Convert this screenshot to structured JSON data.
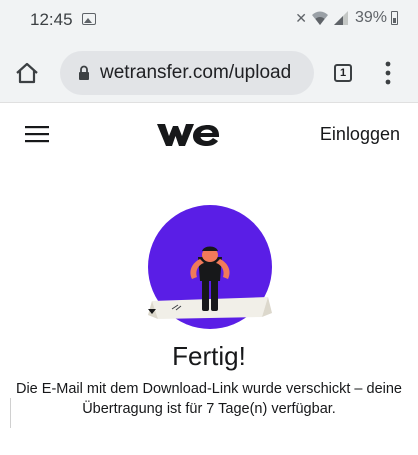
{
  "status_bar": {
    "time": "12:45",
    "battery": "39%"
  },
  "browser": {
    "url": "wetransfer.com/upload",
    "tab_count": "1"
  },
  "header": {
    "login_label": "Einloggen"
  },
  "content": {
    "heading": "Fertig!",
    "message": "Die E-Mail mit dem Download-Link wurde verschickt – deine Übertragung ist für 7 Tage(n) verfügbar."
  },
  "colors": {
    "illustration_bg": "#5a1ee6",
    "figure_skin": "#f07a5a",
    "status_bg": "#f1f3f4"
  }
}
